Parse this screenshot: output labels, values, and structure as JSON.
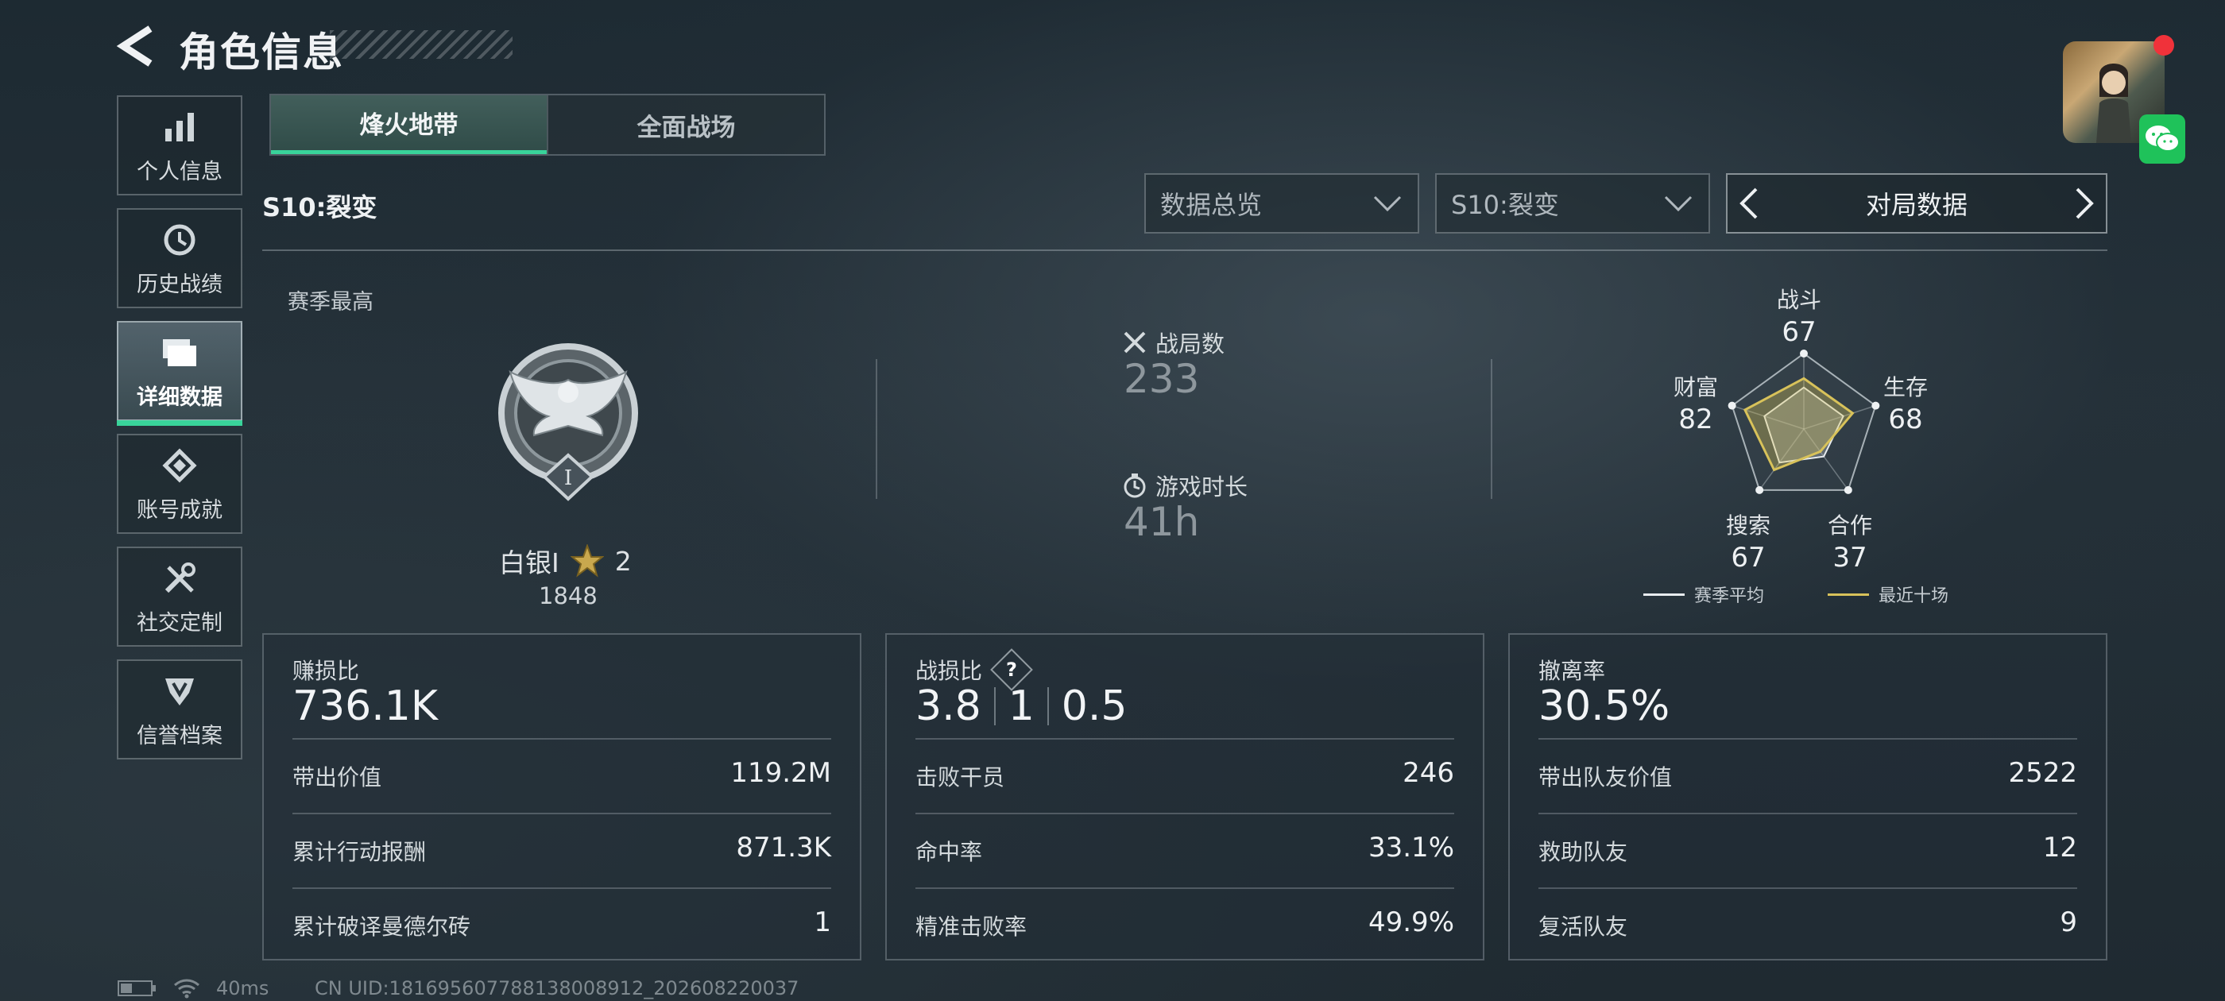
{
  "header": {
    "title": "角色信息"
  },
  "sidebar": {
    "items": [
      {
        "label": "个人信息",
        "icon": "bar-chart-icon"
      },
      {
        "label": "历史战绩",
        "icon": "history-clock-icon"
      },
      {
        "label": "详细数据",
        "icon": "folder-icon",
        "active": true
      },
      {
        "label": "账号成就",
        "icon": "achievement-badge-icon"
      },
      {
        "label": "社交定制",
        "icon": "tools-icon"
      },
      {
        "label": "信誉档案",
        "icon": "shield-badge-icon"
      }
    ]
  },
  "tabs": [
    {
      "label": "烽火地带",
      "active": true
    },
    {
      "label": "全面战场",
      "active": false
    }
  ],
  "season_title": "S10:裂变",
  "filters": {
    "data_type": "数据总览",
    "season": "S10:裂变",
    "nav_label": "对局数据"
  },
  "rank": {
    "section_label": "赛季最高",
    "name": "白银I",
    "stars": "2",
    "score": "1848"
  },
  "overview": {
    "matches_label": "战局数",
    "matches_value": "233",
    "playtime_label": "游戏时长",
    "playtime_value": "41h"
  },
  "radar": {
    "axes": [
      {
        "name": "战斗",
        "value": "67"
      },
      {
        "name": "生存",
        "value": "68"
      },
      {
        "name": "合作",
        "value": "37"
      },
      {
        "name": "搜索",
        "value": "67"
      },
      {
        "name": "财富",
        "value": "82"
      }
    ],
    "season_avg": [
      0.55,
      0.55,
      0.45,
      0.55,
      0.55
    ],
    "recent_ten": [
      0.67,
      0.68,
      0.37,
      0.67,
      0.82
    ],
    "legend": [
      {
        "label": "赛季平均",
        "color": "#e8ecef"
      },
      {
        "label": "最近十场",
        "color": "#d8c25a"
      }
    ]
  },
  "cards": {
    "profit": {
      "title": "赚损比",
      "main": "736.1K",
      "rows": [
        {
          "key": "带出价值",
          "value": "119.2M"
        },
        {
          "key": "累计行动报酬",
          "value": "871.3K"
        },
        {
          "key": "累计破译曼德尔砖",
          "value": "1"
        }
      ]
    },
    "kd": {
      "title": "战损比",
      "help": "?",
      "main_a": "3.8",
      "main_b": "1",
      "main_c": "0.5",
      "rows": [
        {
          "key": "击败干员",
          "value": "246"
        },
        {
          "key": "命中率",
          "value": "33.1%"
        },
        {
          "key": "精准击败率",
          "value": "49.9%"
        }
      ]
    },
    "extract": {
      "title": "撤离率",
      "main": "30.5%",
      "rows": [
        {
          "key": "带出队友价值",
          "value": "2522"
        },
        {
          "key": "救助队友",
          "value": "12"
        },
        {
          "key": "复活队友",
          "value": "9"
        }
      ]
    }
  },
  "status": {
    "ping": "40ms",
    "uid": "CN UID:181695607788138008912_202608220037"
  }
}
